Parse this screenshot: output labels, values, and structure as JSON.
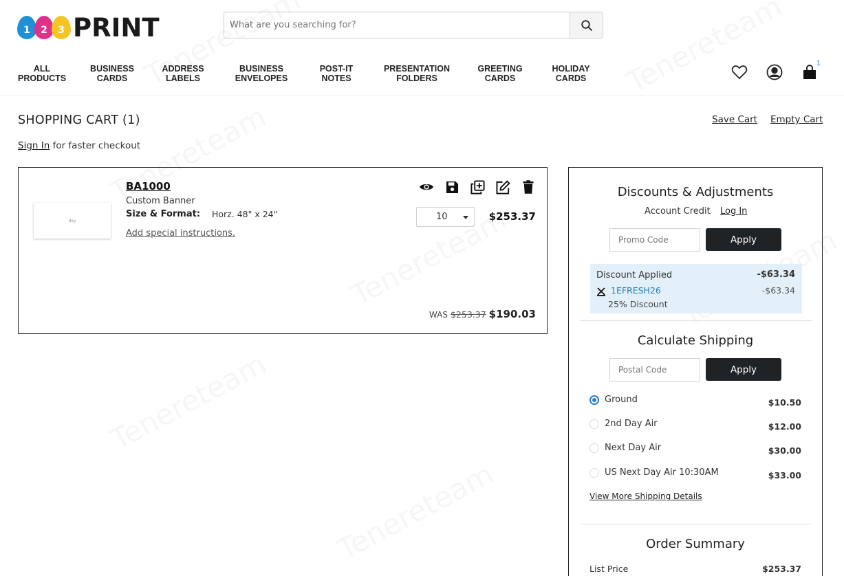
{
  "logo": {
    "drops": [
      {
        "digit": "1",
        "color": "#1f8fd6"
      },
      {
        "digit": "2",
        "color": "#e0308a"
      },
      {
        "digit": "3",
        "color": "#f5c524"
      }
    ],
    "word": "PRINT"
  },
  "search": {
    "placeholder": "What are you searching for?"
  },
  "nav": [
    {
      "line1": "ALL",
      "line2": "PRODUCTS"
    },
    {
      "line1": "BUSINESS",
      "line2": "CARDS"
    },
    {
      "line1": "ADDRESS",
      "line2": "LABELS"
    },
    {
      "line1": "BUSINESS",
      "line2": "ENVELOPES"
    },
    {
      "line1": "POST-IT",
      "line2": "NOTES"
    },
    {
      "line1": "PRESENTATION",
      "line2": "FOLDERS"
    },
    {
      "line1": "GREETING",
      "line2": "CARDS"
    },
    {
      "line1": "HOLIDAY",
      "line2": "CARDS"
    }
  ],
  "header": {
    "cart_count": "1"
  },
  "cart": {
    "title": "SHOPPING CART (1)",
    "save_label": "Save Cart",
    "empty_label": "Empty Cart",
    "signin_link": "Sign In",
    "signin_text": " for faster checkout"
  },
  "item": {
    "sku": "BA1000",
    "name": "Custom Banner",
    "size_label": "Size & Format:",
    "size_value": "Horz. 48\" x 24\"",
    "instructions": "Add special instructions.",
    "thumb_text": "day",
    "qty": "10",
    "price": "$253.37",
    "was_label": "WAS",
    "was_price": "$253.37",
    "new_price": "$190.03"
  },
  "discounts": {
    "title": "Discounts & Adjustments",
    "account_credit": "Account Credit",
    "login": "Log In",
    "promo_placeholder": "Promo Code",
    "apply": "Apply",
    "applied_label": "Discount Applied",
    "applied_total": "-$63.34",
    "code": "1EFRESH26",
    "code_amount": "-$63.34",
    "code_desc": "25% Discount"
  },
  "shipping": {
    "title": "Calculate Shipping",
    "postal_placeholder": "Postal Code",
    "apply": "Apply",
    "options": [
      {
        "name": "Ground",
        "price": "$10.50",
        "selected": true
      },
      {
        "name": "2nd Day Air",
        "price": "$12.00",
        "selected": false
      },
      {
        "name": "Next Day Air",
        "price": "$30.00",
        "selected": false
      },
      {
        "name": "US Next Day Air 10:30AM",
        "price": "$33.00",
        "selected": false
      }
    ],
    "view_more": "View More Shipping Details"
  },
  "summary": {
    "title": "Order Summary",
    "list_price_label": "List Price",
    "list_price_value": "$253.37"
  },
  "colors": {
    "accent_blue": "#2a7fd4",
    "button_dark": "#1f2326",
    "discount_bg": "#e3f0f9"
  }
}
